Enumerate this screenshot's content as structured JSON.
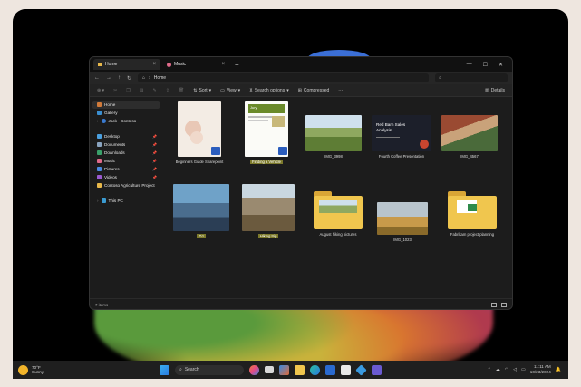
{
  "explorer": {
    "tabs": [
      {
        "label": "Home",
        "active": true
      },
      {
        "label": "Music",
        "active": false
      }
    ],
    "address": "Home",
    "toolbar": {
      "new_label": "",
      "sort_label": "Sort",
      "view_label": "View",
      "filter_label": "Search options",
      "compress_label": "Compressed",
      "more_label": "···",
      "details_label": "Details"
    },
    "sidebar": [
      {
        "label": "Home",
        "icon": "home-icon",
        "selected": true
      },
      {
        "label": "Gallery",
        "icon": "gallery-icon"
      },
      {
        "label": "Jack - Contoso",
        "icon": "cloud-icon"
      },
      {
        "label": "Desktop",
        "icon": "desktop-icon",
        "pinned": true
      },
      {
        "label": "Documents",
        "icon": "documents-icon",
        "pinned": true
      },
      {
        "label": "Downloads",
        "icon": "downloads-icon",
        "pinned": true
      },
      {
        "label": "Music",
        "icon": "music-icon",
        "pinned": true
      },
      {
        "label": "Pictures",
        "icon": "pictures-icon",
        "pinned": true
      },
      {
        "label": "Videos",
        "icon": "videos-icon",
        "pinned": true
      },
      {
        "label": "Contoso Agriculture Project",
        "icon": "folder-icon"
      },
      {
        "label": "This PC",
        "icon": "pc-icon"
      }
    ],
    "files": [
      {
        "name": "Beginners Guide Sharepoint",
        "highlight": false
      },
      {
        "name": "Finding a Vehicle",
        "highlight": true
      },
      {
        "name": "IMG_3998",
        "highlight": false
      },
      {
        "name": "Fourth Coffee Presentation",
        "highlight": false
      },
      {
        "name": "IMG_4567",
        "highlight": false
      },
      {
        "name": "DJ",
        "highlight": true
      },
      {
        "name": "Hiking trip",
        "highlight": true
      },
      {
        "name": "August hiking pictures",
        "highlight": false
      },
      {
        "name": "IMG_1023",
        "highlight": false
      },
      {
        "name": "Fabrikam project planning",
        "highlight": false
      }
    ],
    "doc_thumbs": {
      "doc2_title": "Jury",
      "ppt_title": "Red Barn Sales Analysis"
    },
    "status": "7 items"
  },
  "taskbar": {
    "temp": "70°F",
    "condition": "Sunny",
    "search_label": "Search",
    "time": "11:11 AM",
    "date": "10/23/2024"
  }
}
